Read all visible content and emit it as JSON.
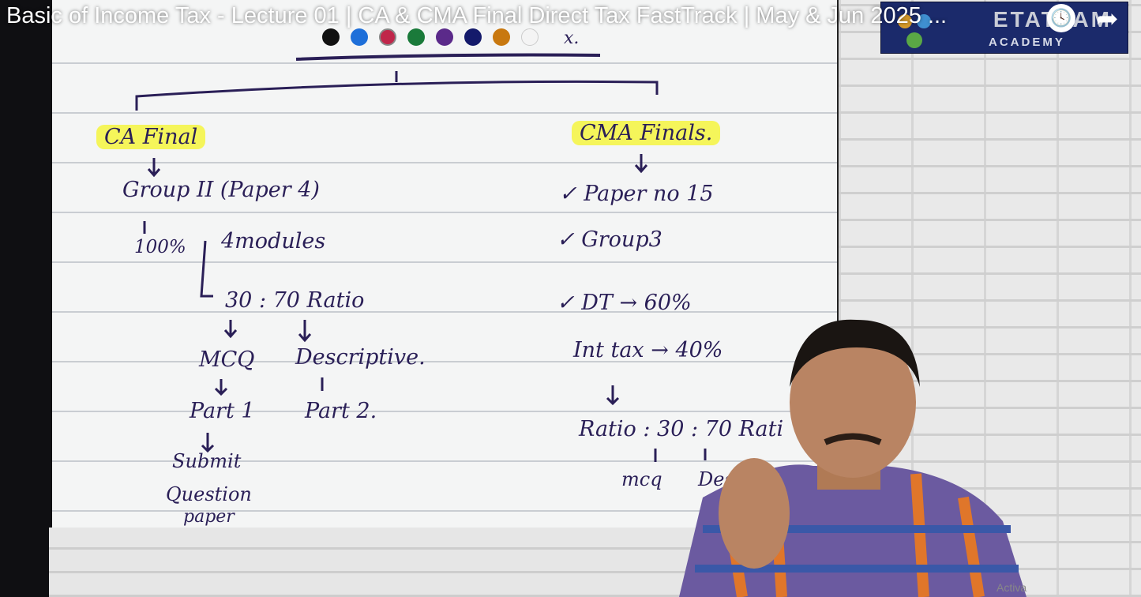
{
  "video": {
    "title": "Basic of Income Tax - Lecture 01 | CA & CMA Final Direct Tax FastTrack | May & Jun 2025 ...",
    "watch_later_icon": "clock-icon",
    "share_icon": "share-arrow-icon"
  },
  "logo": {
    "brand": "ETATVAM",
    "subtitle": "ACADEMY"
  },
  "palette": {
    "colors": [
      "#111111",
      "#1e6fd9",
      "#c0264a",
      "#1a7a3a",
      "#5b2a8a",
      "#141a6b",
      "#c8780f",
      "#e8e8e8"
    ],
    "eraser_label": "x."
  },
  "board": {
    "left": {
      "heading": "CA Final",
      "group": "Group II (Paper 4)",
      "percent": "100%",
      "modules": "4modules",
      "ratio": "30 : 70 Ratio",
      "mcq": "MCQ",
      "descriptive": "Descriptive.",
      "part1": "Part 1",
      "part2": "Part 2.",
      "submit": "Submit",
      "question": "Question",
      "paper": "paper"
    },
    "right": {
      "heading": "CMA Finals.",
      "paper": "✓ Paper no 15",
      "group": "✓ Group3",
      "dt": "✓ DT → 60%",
      "inttax": "Int tax → 40%",
      "ratio": "Ratio : 30 : 70 Rati",
      "mcq": "mcq",
      "desc": "Des"
    }
  },
  "watermark": "Activa"
}
